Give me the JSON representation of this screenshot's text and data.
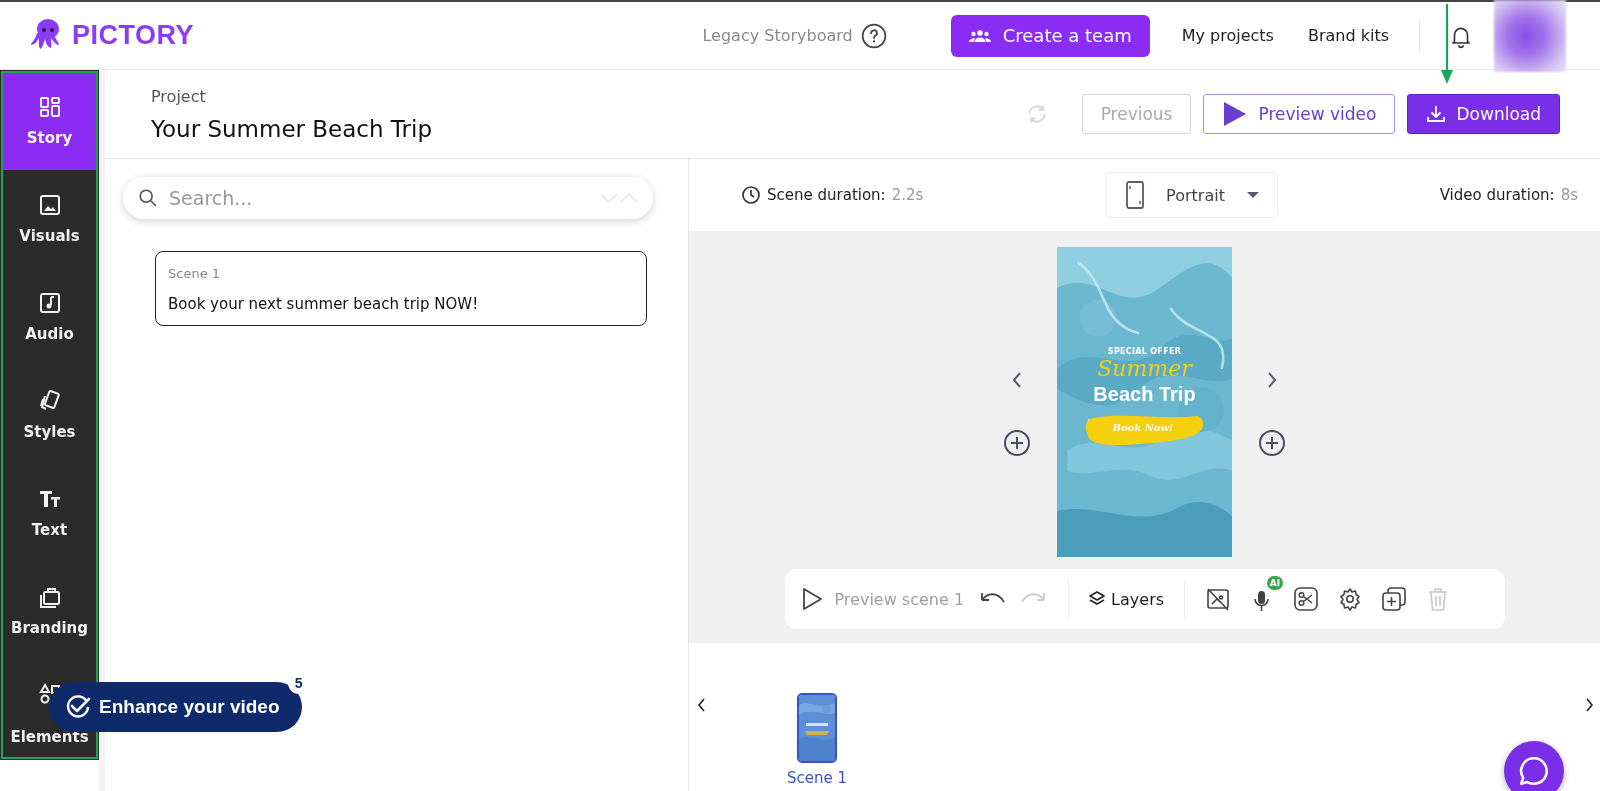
{
  "header": {
    "brand": "PICTORY",
    "legacy_link": "Legacy Storyboard",
    "create_team": "Create a team",
    "nav": [
      "My projects",
      "Brand kits"
    ]
  },
  "sidebar": {
    "highlighted": true,
    "items": [
      {
        "kind": "story",
        "label": "Story",
        "selected": true
      },
      {
        "kind": "visuals",
        "label": "Visuals",
        "selected": false
      },
      {
        "kind": "audio",
        "label": "Audio",
        "selected": false
      },
      {
        "kind": "styles",
        "label": "Styles",
        "selected": false
      },
      {
        "kind": "text",
        "label": "Text",
        "selected": false
      },
      {
        "kind": "branding",
        "label": "Branding",
        "selected": false
      },
      {
        "kind": "elements",
        "label": "Elements",
        "selected": false
      }
    ]
  },
  "project": {
    "label": "Project",
    "title": "Your Summer Beach Trip"
  },
  "actions": {
    "previous": {
      "label": "Previous",
      "disabled": true
    },
    "preview": "Preview video",
    "download": "Download",
    "download_pointer": true
  },
  "search": {
    "placeholder": "Search..."
  },
  "scenes": [
    {
      "label": "Scene 1",
      "text": "Book your next summer beach trip NOW!",
      "selected": true
    }
  ],
  "scene_bar": {
    "scene_duration_label": "Scene duration:",
    "scene_duration": "2.2s",
    "orientation": "Portrait",
    "video_duration_label": "Video duration:",
    "video_duration": "8s"
  },
  "preview_frame": {
    "kicker": "SPECIAL OFFER",
    "script_title": "Summer",
    "title": "Beach Trip",
    "cta": "Book Now!"
  },
  "toolbar": {
    "preview_scene": "Preview scene 1",
    "undo_disabled": false,
    "redo_disabled": true,
    "layers": "Layers",
    "tools": [
      {
        "kind": "hide-visual",
        "disabled": false
      },
      {
        "kind": "voice",
        "badge": "AI",
        "disabled": false
      },
      {
        "kind": "cut",
        "disabled": false
      },
      {
        "kind": "settings",
        "disabled": false
      },
      {
        "kind": "duplicate",
        "disabled": false
      },
      {
        "kind": "delete",
        "disabled": true
      }
    ]
  },
  "timeline": [
    {
      "label": "Scene 1",
      "selected": true
    }
  ],
  "enhance": {
    "label": "Enhance your video",
    "count": "5"
  }
}
